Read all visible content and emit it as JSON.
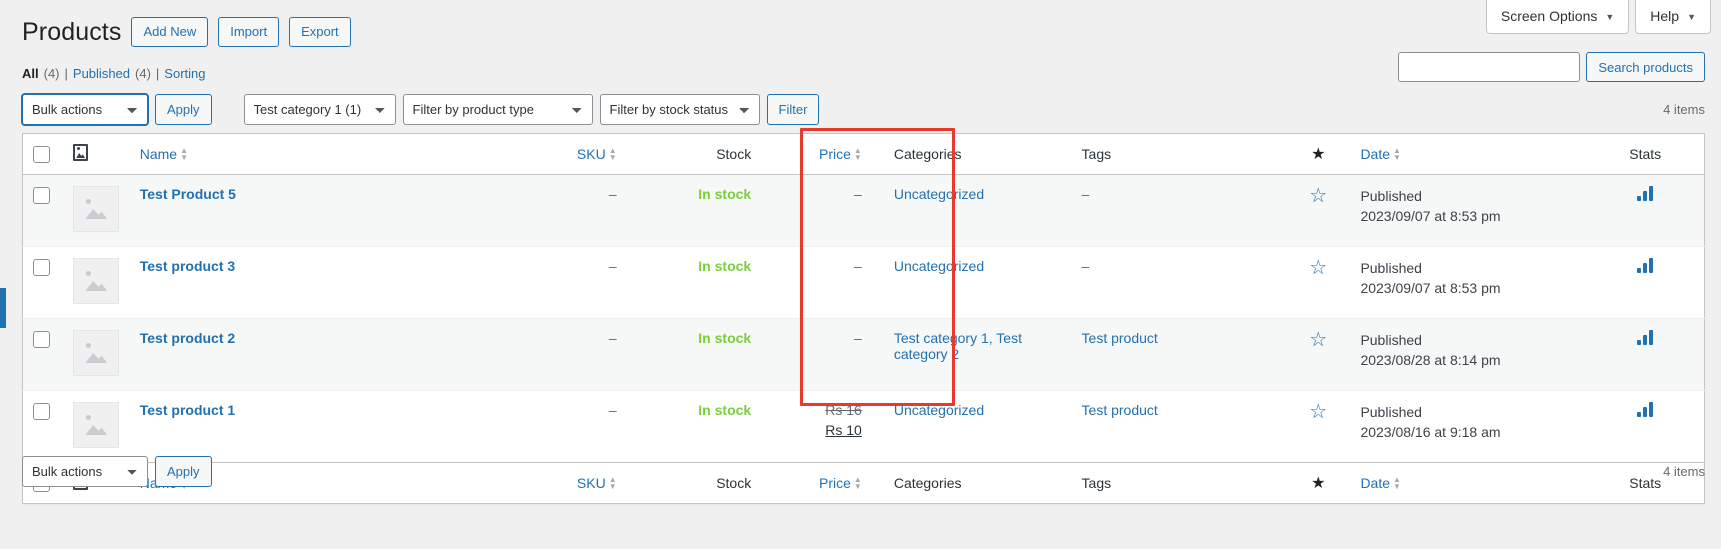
{
  "screen_meta": {
    "screen_options_label": "Screen Options",
    "help_label": "Help",
    "caret": "▼"
  },
  "header": {
    "title": "Products",
    "actions": [
      {
        "label": "Add New",
        "name": "add-new-button"
      },
      {
        "label": "Import",
        "name": "import-button"
      },
      {
        "label": "Export",
        "name": "export-button"
      }
    ]
  },
  "status_links": {
    "all_label": "All",
    "all_count": "(4)",
    "published_label": "Published",
    "published_count": "(4)",
    "sorting_label": "Sorting",
    "separator": "|"
  },
  "search": {
    "value": "",
    "placeholder": "",
    "button_label": "Search products"
  },
  "tablenav_top": {
    "bulk_actions_label": "Bulk actions",
    "apply_label": "Apply",
    "category_filter_label": "Test category 1  (1)",
    "product_type_filter_label": "Filter by product type",
    "stock_status_filter_label": "Filter by stock status",
    "filter_label": "Filter",
    "displaying_num": "4 items"
  },
  "tablenav_bottom": {
    "bulk_actions_label": "Bulk actions",
    "apply_label": "Apply",
    "displaying_num": "4 items"
  },
  "table": {
    "columns": {
      "thumb": "",
      "name": "Name",
      "sku": "SKU",
      "stock": "Stock",
      "price": "Price",
      "categories": "Categories",
      "tags": "Tags",
      "featured": "★",
      "date": "Date",
      "stats": "Stats"
    },
    "rows": [
      {
        "name": "Test Product 5",
        "sku": "–",
        "stock": "In stock",
        "price": "–",
        "price_sale": "",
        "categories": "Uncategorized",
        "tags": "–",
        "tags_is_link": false,
        "featured": "☆",
        "date_status": "Published",
        "date_value": "2023/09/07 at 8:53 pm"
      },
      {
        "name": "Test product 3",
        "sku": "–",
        "stock": "In stock",
        "price": "–",
        "price_sale": "",
        "categories": "Uncategorized",
        "tags": "–",
        "tags_is_link": false,
        "featured": "☆",
        "date_status": "Published",
        "date_value": "2023/09/07 at 8:53 pm"
      },
      {
        "name": "Test product 2",
        "sku": "–",
        "stock": "In stock",
        "price": "–",
        "price_sale": "",
        "categories": "Test category 1, Test category 2",
        "tags": "Test product",
        "tags_is_link": true,
        "featured": "☆",
        "date_status": "Published",
        "date_value": "2023/08/28 at 8:14 pm"
      },
      {
        "name": "Test product 1",
        "sku": "–",
        "stock": "In stock",
        "price": "Rs 16",
        "price_sale": "Rs 10",
        "categories": "Uncategorized",
        "tags": "Test product",
        "tags_is_link": true,
        "featured": "☆",
        "date_status": "Published",
        "date_value": "2023/08/16 at 9:18 am"
      }
    ]
  },
  "annotation": {
    "color": "#e8392e",
    "target_column": "Categories"
  }
}
